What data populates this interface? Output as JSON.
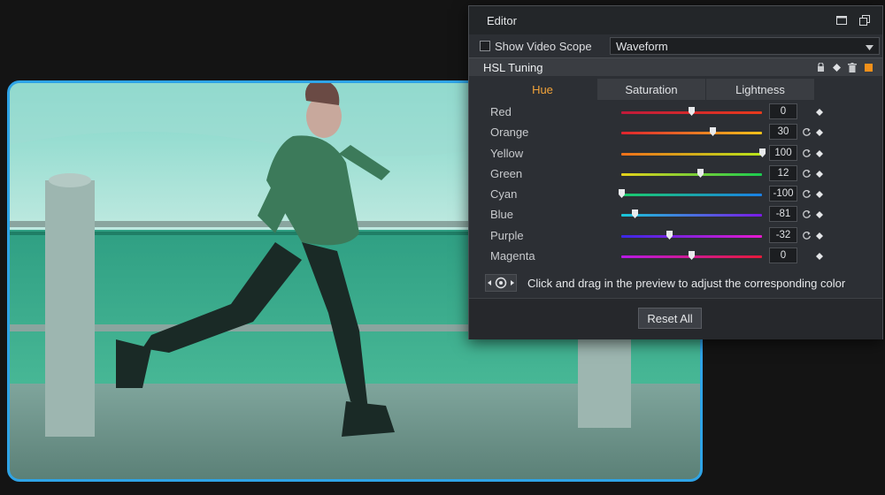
{
  "editor": {
    "title": "Editor",
    "show_video_scope": {
      "label": "Show Video Scope",
      "checked": false
    },
    "scope_select": {
      "value": "Waveform"
    },
    "section": {
      "title": "HSL Tuning"
    },
    "tabs": [
      {
        "label": "Hue",
        "active": true
      },
      {
        "label": "Saturation",
        "active": false
      },
      {
        "label": "Lightness",
        "active": false
      }
    ],
    "sliders": [
      {
        "name": "red",
        "label": "Red",
        "value": "0",
        "fraction": 0.5,
        "gradient": [
          "#c01a3a",
          "#e83a1c"
        ],
        "reset": false
      },
      {
        "name": "orange",
        "label": "Orange",
        "value": "30",
        "fraction": 0.65,
        "gradient": [
          "#e0242e",
          "#f2c21a"
        ],
        "reset": true
      },
      {
        "name": "yellow",
        "label": "Yellow",
        "value": "100",
        "fraction": 1.0,
        "gradient": [
          "#f0701a",
          "#b8e61a"
        ],
        "reset": true
      },
      {
        "name": "green",
        "label": "Green",
        "value": "12",
        "fraction": 0.56,
        "gradient": [
          "#e6d21a",
          "#1acc50"
        ],
        "reset": true
      },
      {
        "name": "cyan",
        "label": "Cyan",
        "value": "-100",
        "fraction": 0.0,
        "gradient": [
          "#1acc6a",
          "#1a80e6"
        ],
        "reset": true
      },
      {
        "name": "blue",
        "label": "Blue",
        "value": "-81",
        "fraction": 0.095,
        "gradient": [
          "#18c8d8",
          "#7a1ae6"
        ],
        "reset": true
      },
      {
        "name": "purple",
        "label": "Purple",
        "value": "-32",
        "fraction": 0.34,
        "gradient": [
          "#3a28e6",
          "#e61ad0"
        ],
        "reset": true
      },
      {
        "name": "magenta",
        "label": "Magenta",
        "value": "0",
        "fraction": 0.5,
        "gradient": [
          "#b81ae6",
          "#e61a3a"
        ],
        "reset": false
      }
    ],
    "hint": "Click and drag in the preview to adjust the corresponding color",
    "reset_all_label": "Reset All",
    "accent_color": "#f2a33a",
    "preview_border_color": "#2fa4e7"
  }
}
